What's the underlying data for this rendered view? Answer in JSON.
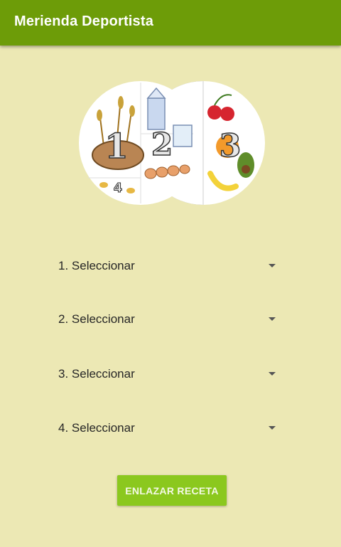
{
  "app_bar": {
    "title": "Merienda Deportista"
  },
  "spinners": [
    {
      "label": "1. Seleccionar"
    },
    {
      "label": "2. Seleccionar"
    },
    {
      "label": "3. Seleccionar"
    },
    {
      "label": "4. Seleccionar"
    }
  ],
  "action_button": {
    "label": "ENLAZAR RECETA"
  },
  "hero_image": {
    "icon": "food-groups-wheel-icon",
    "groups": [
      "1",
      "2",
      "3",
      "4"
    ]
  },
  "colors": {
    "app_bar": "#6d9c08",
    "background": "#ece8b4",
    "button": "#8bc81e",
    "button_text": "#f4f9e6"
  }
}
